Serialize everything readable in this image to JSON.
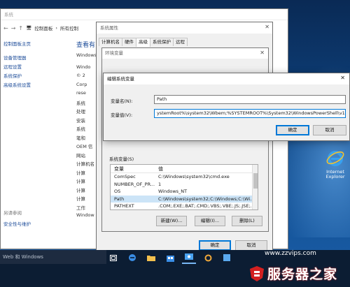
{
  "desktop": {
    "icon_label_1": "Internet",
    "icon_label_2": "Explorer"
  },
  "system_window": {
    "title": "系统",
    "address_1": "控制面板",
    "address_2": "所有控制",
    "sidebar_title": "控制面板主页",
    "sidebar_items": [
      "设备管理器",
      "远程设置",
      "系统保护",
      "高级系统设置"
    ],
    "see_also": "另请参阅",
    "security": "安全性与维护",
    "main_heading": "查看有",
    "main_lines": [
      "Windows",
      "Windo",
      "© 2",
      "Corp",
      "rese",
      "系统",
      "处理",
      "安装",
      "系统",
      "笔和",
      "OEM 信",
      "网站",
      "计算机名",
      "计算",
      "计算",
      "计算",
      "计算",
      "工作",
      "Window"
    ]
  },
  "system_properties": {
    "title": "系统属性",
    "close": "✕",
    "tabs": [
      "计算机名",
      "硬件",
      "高级",
      "系统保护",
      "远程"
    ],
    "active_tab": 2,
    "ok": "确定",
    "cancel": "取消"
  },
  "env_vars": {
    "title": "环境变量",
    "close": "✕",
    "sys_vars_label": "系统变量(S)",
    "col_var": "变量",
    "col_val": "值",
    "rows": [
      {
        "name": "ComSpec",
        "value": "C:\\Windows\\system32\\cmd.exe"
      },
      {
        "name": "NUMBER_OF_PR...",
        "value": "1"
      },
      {
        "name": "OS",
        "value": "Windows_NT"
      },
      {
        "name": "Path",
        "value": "C:\\Windows\\system32;C:\\Windows;C:\\Wi..."
      },
      {
        "name": "PATHEXT",
        "value": ".COM;.EXE;.BAT;.CMD;.VBS;.VBE;.JS;.JSE;..."
      }
    ],
    "selected_row": 3,
    "btn_new": "新建(W)...",
    "btn_edit": "编辑(I)...",
    "btn_delete": "删除(L)"
  },
  "edit_dialog": {
    "title": "编辑系统变量",
    "close": "✕",
    "name_label": "变量名(N):",
    "name_value": "Path",
    "value_label": "变量值(V):",
    "value_value": "ystemRoot%\\system32\\Wbem;%SYSTEMROOT%\\System32\\WindowsPowerShell\\v1.0\\;",
    "ok": "确定",
    "cancel": "取消"
  },
  "taskbar": {
    "search_text": "Web 和 Windows"
  },
  "watermark": {
    "url": "www.zzvips.com",
    "text": "服务器之家"
  },
  "colors": {
    "accent": "#0078d7",
    "link": "#1f4e9a",
    "taskbar": "#0c1d33",
    "selected_row": "#cce4f7"
  }
}
